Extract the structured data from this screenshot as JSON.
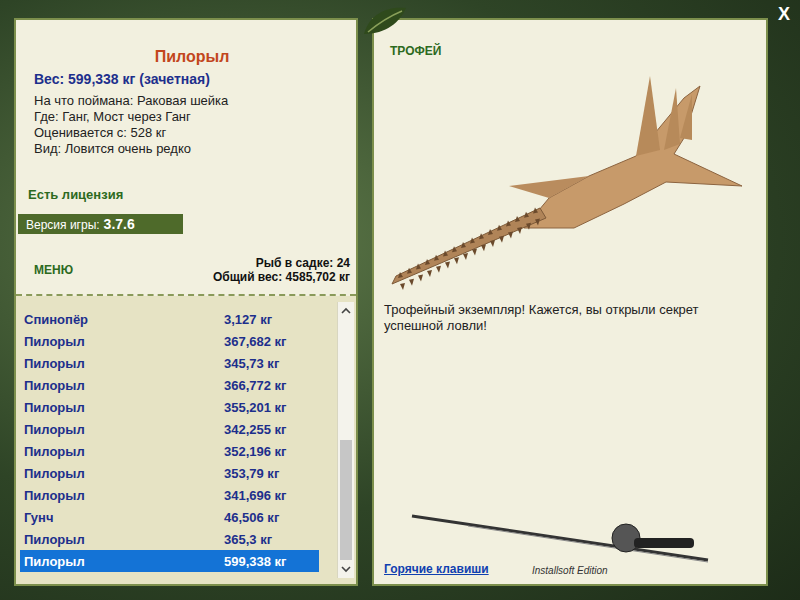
{
  "window": {
    "close": "X"
  },
  "fish_card": {
    "name": "Пилорыл",
    "weight": "Вес: 599,338 кг (зачетная)",
    "details": [
      "На что поймана: Раковая шейка",
      "Где: Ганг, Мост через Ганг",
      "Оценивается с: 528 кг",
      "Вид: Ловится очень редко"
    ],
    "license": "Есть лицензия"
  },
  "version": {
    "label": "Версия игры:",
    "value": "3.7.6"
  },
  "menu": {
    "label": "МЕНЮ"
  },
  "keepnet": {
    "count": "Рыб в садке: 24",
    "total": "Общий вес: 4585,702 кг"
  },
  "catch_list": {
    "rows": [
      {
        "name": "Спинопёр",
        "weight": "3,127 кг",
        "selected": false
      },
      {
        "name": "Пилорыл",
        "weight": "367,682 кг",
        "selected": false
      },
      {
        "name": "Пилорыл",
        "weight": "345,73 кг",
        "selected": false
      },
      {
        "name": "Пилорыл",
        "weight": "366,772 кг",
        "selected": false
      },
      {
        "name": "Пилорыл",
        "weight": "355,201 кг",
        "selected": false
      },
      {
        "name": "Пилорыл",
        "weight": "342,255 кг",
        "selected": false
      },
      {
        "name": "Пилорыл",
        "weight": "352,196 кг",
        "selected": false
      },
      {
        "name": "Пилорыл",
        "weight": "353,79 кг",
        "selected": false
      },
      {
        "name": "Пилорыл",
        "weight": "341,696 кг",
        "selected": false
      },
      {
        "name": "Гунч",
        "weight": "46,506 кг",
        "selected": false
      },
      {
        "name": "Пилорыл",
        "weight": "365,3 кг",
        "selected": false
      },
      {
        "name": "Пилорыл",
        "weight": "599,338 кг",
        "selected": true
      }
    ],
    "scrollbar": {
      "level": 0.5
    }
  },
  "trophy": {
    "title": "ТРОФЕЙ",
    "message": "Трофейный экземпляр! Кажется, вы открыли секрет успешной ловли!",
    "edition": "Installsoft Edition"
  },
  "hotkeys_link": "Горячие клавиши"
}
